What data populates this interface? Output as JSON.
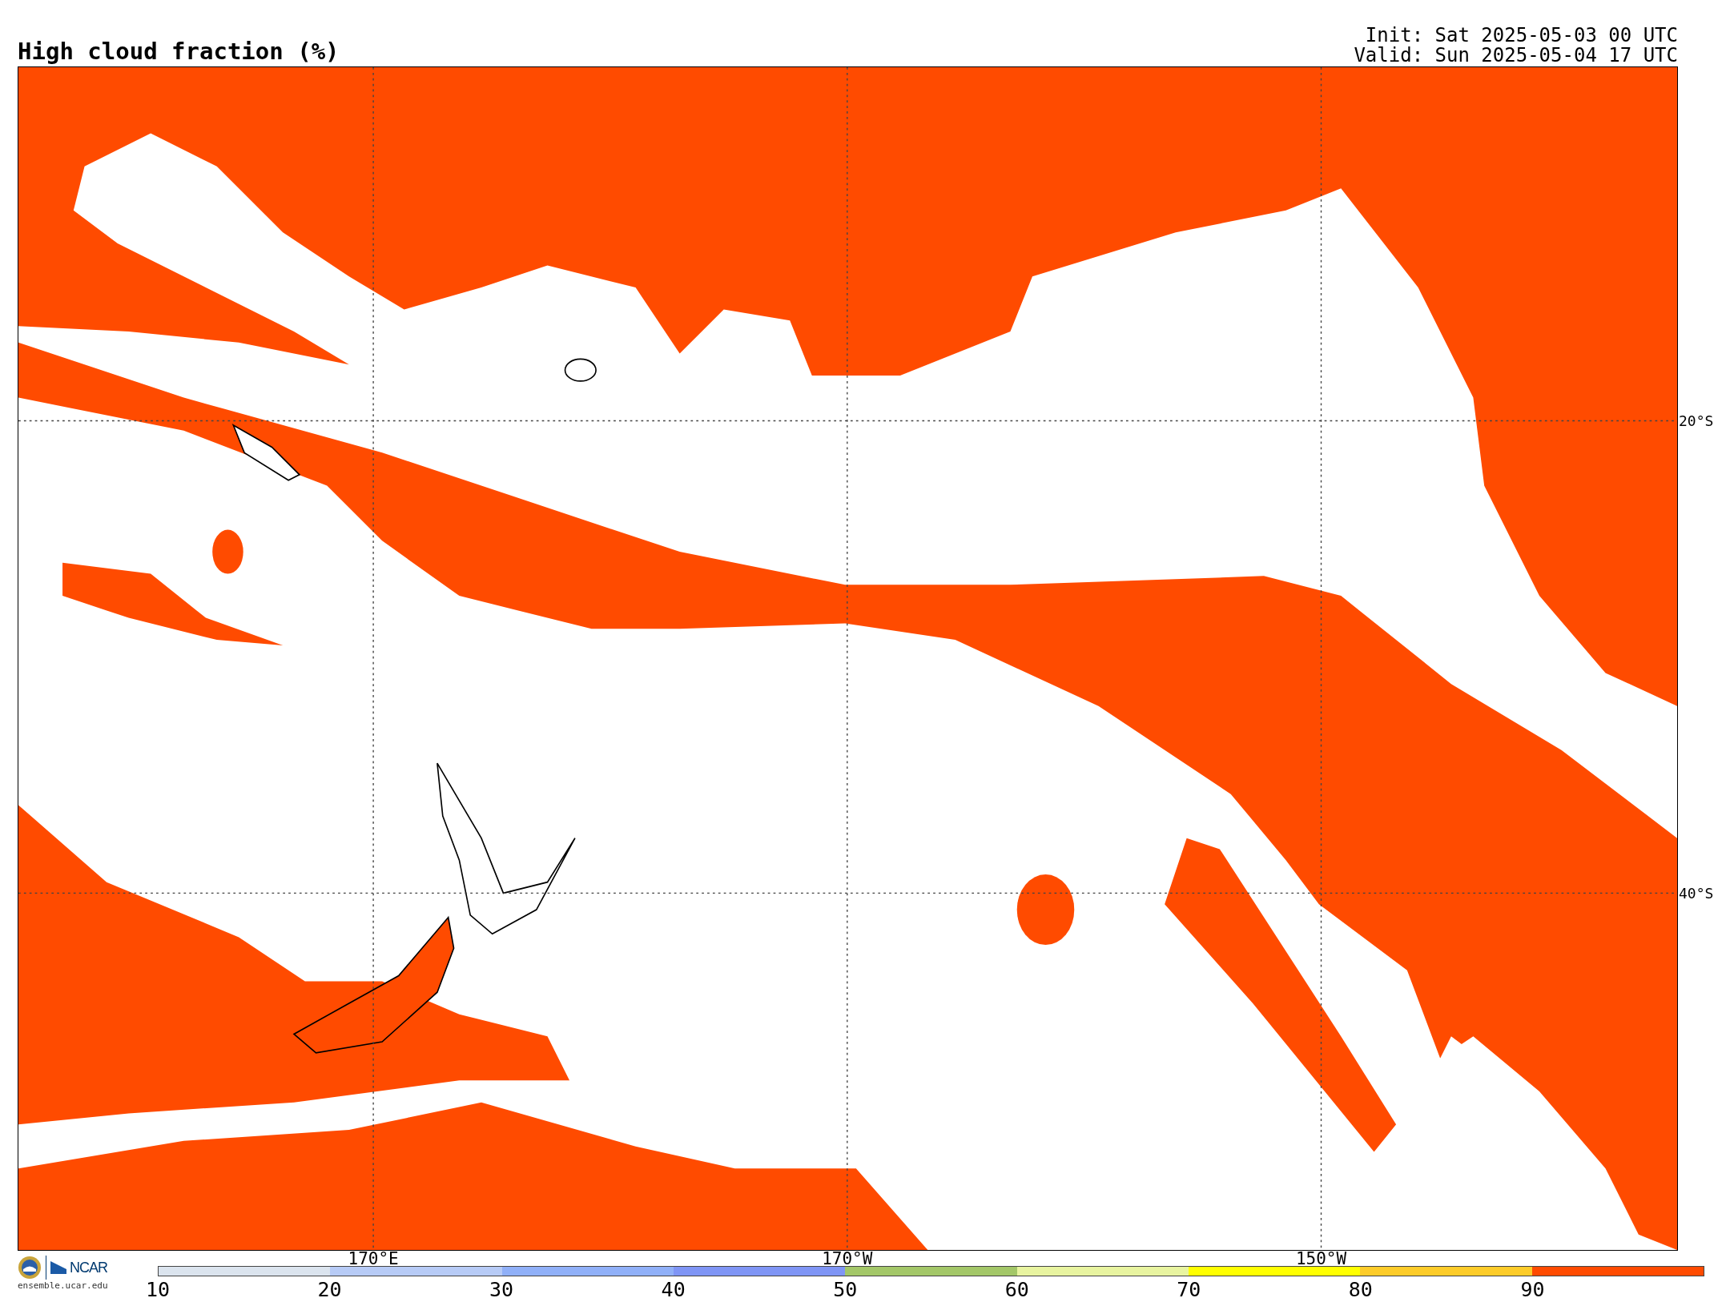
{
  "title": "High cloud fraction (%)",
  "init": "Init: Sat 2025-05-03 00 UTC",
  "valid": "Valid: Sun 2025-05-04 17 UTC",
  "map": {
    "lat_labels": [
      "20°S",
      "40°S"
    ],
    "lon_labels": [
      "170°E",
      "170°W",
      "150°W"
    ]
  },
  "colorbar": {
    "segments": [
      {
        "color": "#dbe4ee"
      },
      {
        "color": "#b7cbf6"
      },
      {
        "color": "#90b0f8"
      },
      {
        "color": "#7f95f5"
      },
      {
        "color": "#a3c768"
      },
      {
        "color": "#e8f4a0"
      },
      {
        "color": "#ffff00"
      },
      {
        "color": "#fdcc2a"
      },
      {
        "color": "#ff4b00"
      }
    ],
    "ticks": [
      "10",
      "20",
      "30",
      "40",
      "50",
      "60",
      "70",
      "80",
      "90"
    ]
  },
  "footer": {
    "logo_text": "NCAR",
    "url": "ensemble.ucar.edu"
  }
}
